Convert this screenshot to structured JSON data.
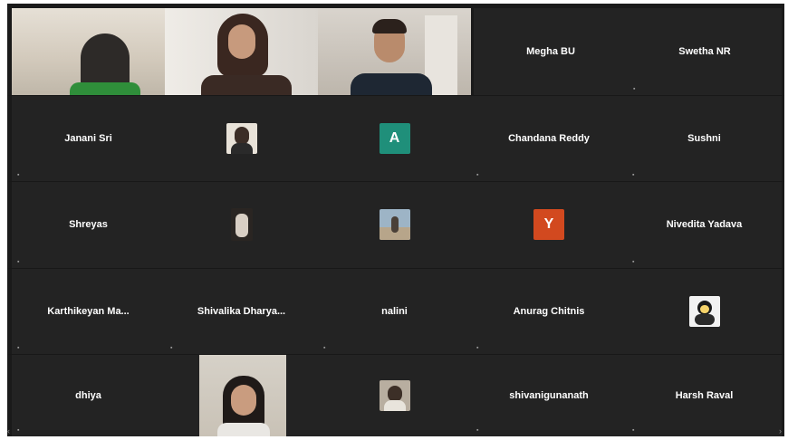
{
  "window": {
    "title": ""
  },
  "participants": {
    "video": [
      {
        "name": ""
      },
      {
        "name": ""
      },
      {
        "name": ""
      }
    ],
    "r0": [
      {
        "name": "Megha BU"
      },
      {
        "name": "Swetha NR"
      }
    ],
    "r1": [
      {
        "name": "Janani Sri"
      },
      {
        "name": "",
        "caption": ""
      },
      {
        "name": "",
        "avatar_letter": "A",
        "avatar_color": "#1f8f7a"
      },
      {
        "name": "Chandana Reddy"
      },
      {
        "name": "Sushni"
      }
    ],
    "r2": [
      {
        "name": "Shreyas"
      },
      {
        "name": "",
        "caption": ""
      },
      {
        "name": "",
        "caption": ""
      },
      {
        "name": "",
        "avatar_letter": "Y",
        "avatar_color": "#d2491f",
        "caption": ""
      },
      {
        "name": "Nivedita Yadava"
      }
    ],
    "r3": [
      {
        "name": "Karthikeyan Ma..."
      },
      {
        "name": "Shivalika Dharya..."
      },
      {
        "name": "nalini"
      },
      {
        "name": "Anurag Chitnis"
      },
      {
        "name": "",
        "caption": ""
      }
    ],
    "r4": [
      {
        "name": "dhiya"
      },
      {
        "name": ""
      },
      {
        "name": ""
      },
      {
        "name": "shivanigunanath"
      },
      {
        "name": "Harsh Raval"
      }
    ]
  }
}
